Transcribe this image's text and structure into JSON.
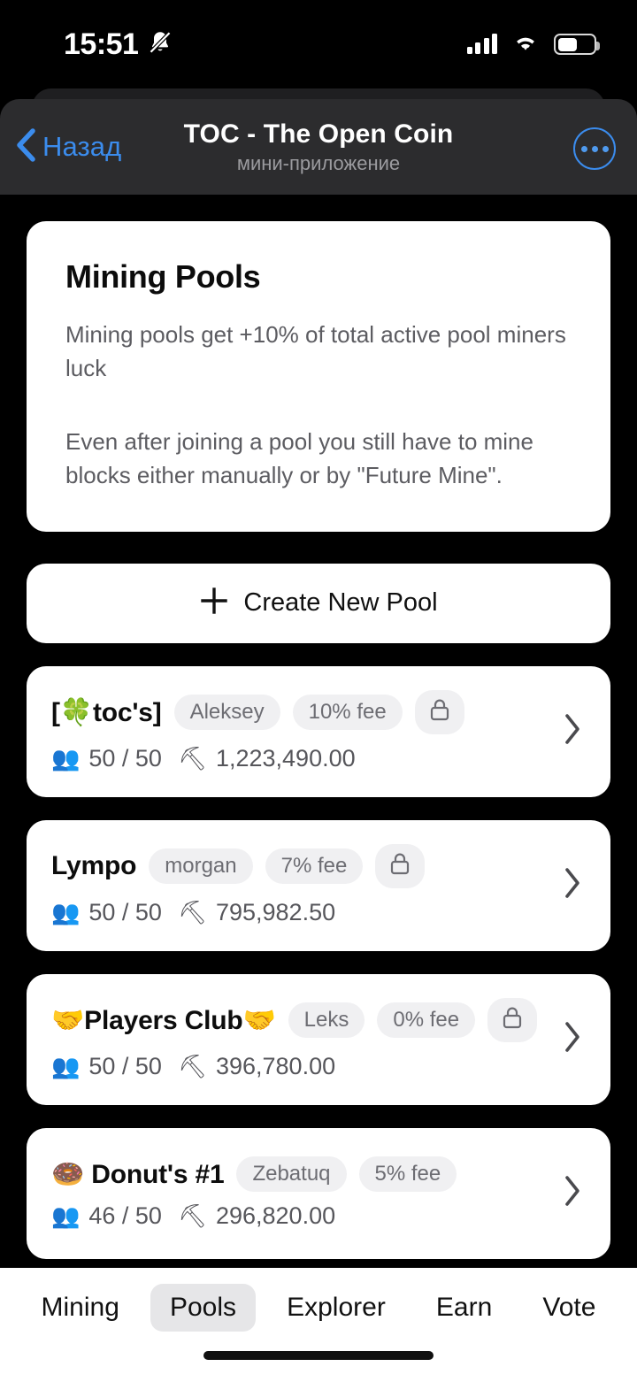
{
  "status_bar": {
    "time": "15:51",
    "silent_icon": "bell-slash-icon",
    "signal_icon": "cellular-signal-icon",
    "wifi_icon": "wifi-icon",
    "battery_icon": "battery-icon",
    "battery_level_percent": 55
  },
  "header": {
    "back_label": "Назад",
    "back_icon": "chevron-left-icon",
    "title": "TOC - The Open Coin",
    "subtitle": "мини-приложение",
    "more_icon": "more-horizontal-icon",
    "accent_color": "#3b8ced",
    "bar_color": "#2c2c2e"
  },
  "info": {
    "title": "Mining Pools",
    "paragraph1": "Mining pools get +10% of total active pool miners luck",
    "paragraph2": "Even after joining a pool you still have to mine blocks either manually or by \"Future Mine\"."
  },
  "create_pool": {
    "label": "Create New Pool",
    "icon": "plus-icon"
  },
  "pools": [
    {
      "name": "[🍀toc's]",
      "owner": "Aleksey",
      "fee": "10% fee",
      "locked": true,
      "members_icon": "busts-in-silhouette-emoji",
      "members": "50 / 50",
      "hashrate_icon": "pick-emoji",
      "hashrate": "1,223,490.00",
      "chevron_icon": "chevron-right-icon"
    },
    {
      "name": "Lympo",
      "owner": "morgan",
      "fee": "7% fee",
      "locked": true,
      "members_icon": "busts-in-silhouette-emoji",
      "members": "50 / 50",
      "hashrate_icon": "pick-emoji",
      "hashrate": "795,982.50",
      "chevron_icon": "chevron-right-icon"
    },
    {
      "name": "🤝Players Club🤝",
      "owner": "Leks",
      "fee": "0% fee",
      "locked": true,
      "members_icon": "busts-in-silhouette-emoji",
      "members": "50 / 50",
      "hashrate_icon": "pick-emoji",
      "hashrate": "396,780.00",
      "chevron_icon": "chevron-right-icon"
    },
    {
      "name": "🍩 Donut's #1",
      "owner": "Zebatuq",
      "fee": "5% fee",
      "locked": false,
      "members_icon": "busts-in-silhouette-emoji",
      "members": "46 / 50",
      "hashrate_icon": "pick-emoji",
      "hashrate": "296,820.00",
      "chevron_icon": "chevron-right-icon"
    }
  ],
  "tabs": [
    {
      "label": "Mining",
      "active": false
    },
    {
      "label": "Pools",
      "active": true
    },
    {
      "label": "Explorer",
      "active": false
    },
    {
      "label": "Earn",
      "active": false
    },
    {
      "label": "Vote",
      "active": false
    }
  ]
}
